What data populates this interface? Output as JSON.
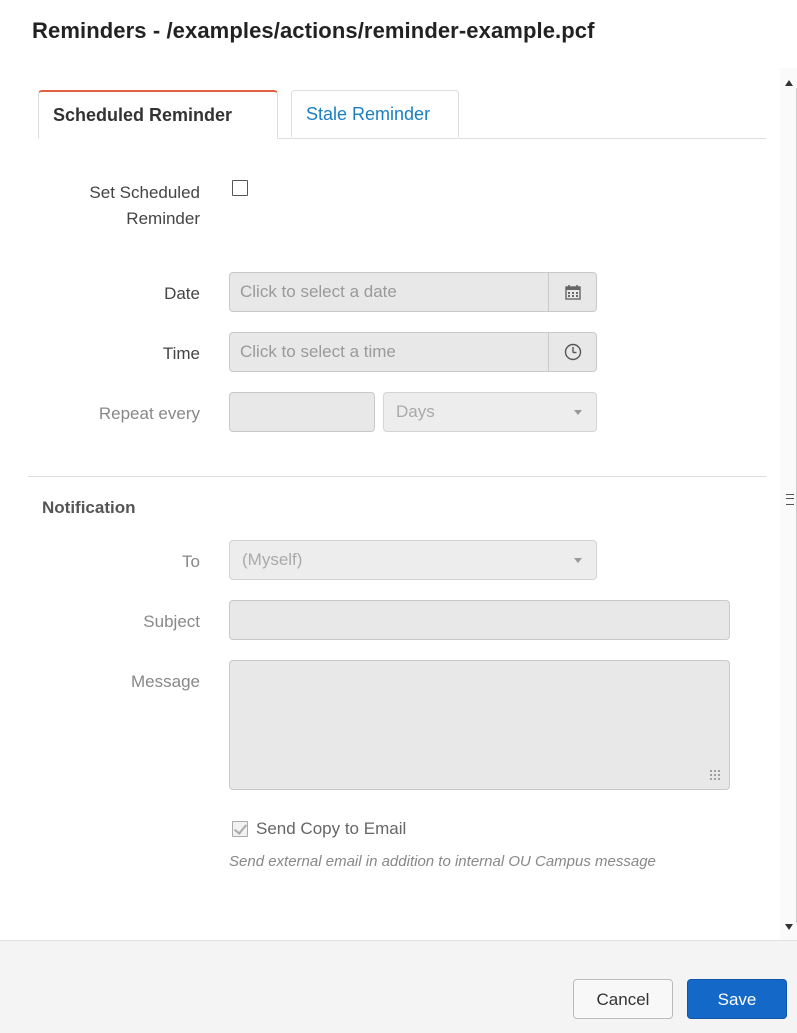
{
  "dialog": {
    "title": "Reminders - /examples/actions/reminder-example.pcf"
  },
  "tabs": [
    {
      "label": "Scheduled Reminder",
      "active": true
    },
    {
      "label": "Stale Reminder",
      "active": false
    }
  ],
  "schedule": {
    "set_label_line1": "Set Scheduled",
    "set_label_line2": "Reminder",
    "set_checked": false,
    "date_label": "Date",
    "date_placeholder": "Click to select a date",
    "date_icon": "calendar-icon",
    "time_label": "Time",
    "time_placeholder": "Click to select a time",
    "time_icon": "clock-icon",
    "repeat_label": "Repeat every",
    "repeat_value": "",
    "repeat_unit": "Days"
  },
  "notification": {
    "heading": "Notification",
    "to_label": "To",
    "to_value": "(Myself)",
    "subject_label": "Subject",
    "subject_value": "",
    "message_label": "Message",
    "message_value": "",
    "send_copy_label": "Send Copy to Email",
    "send_copy_checked": true,
    "help_text": "Send external email in addition to internal OU Campus message"
  },
  "footer": {
    "cancel_label": "Cancel",
    "save_label": "Save"
  },
  "colors": {
    "accent": "#1468c7",
    "tab_link": "#1a7fc1",
    "active_tab_border": "#e0623e"
  }
}
